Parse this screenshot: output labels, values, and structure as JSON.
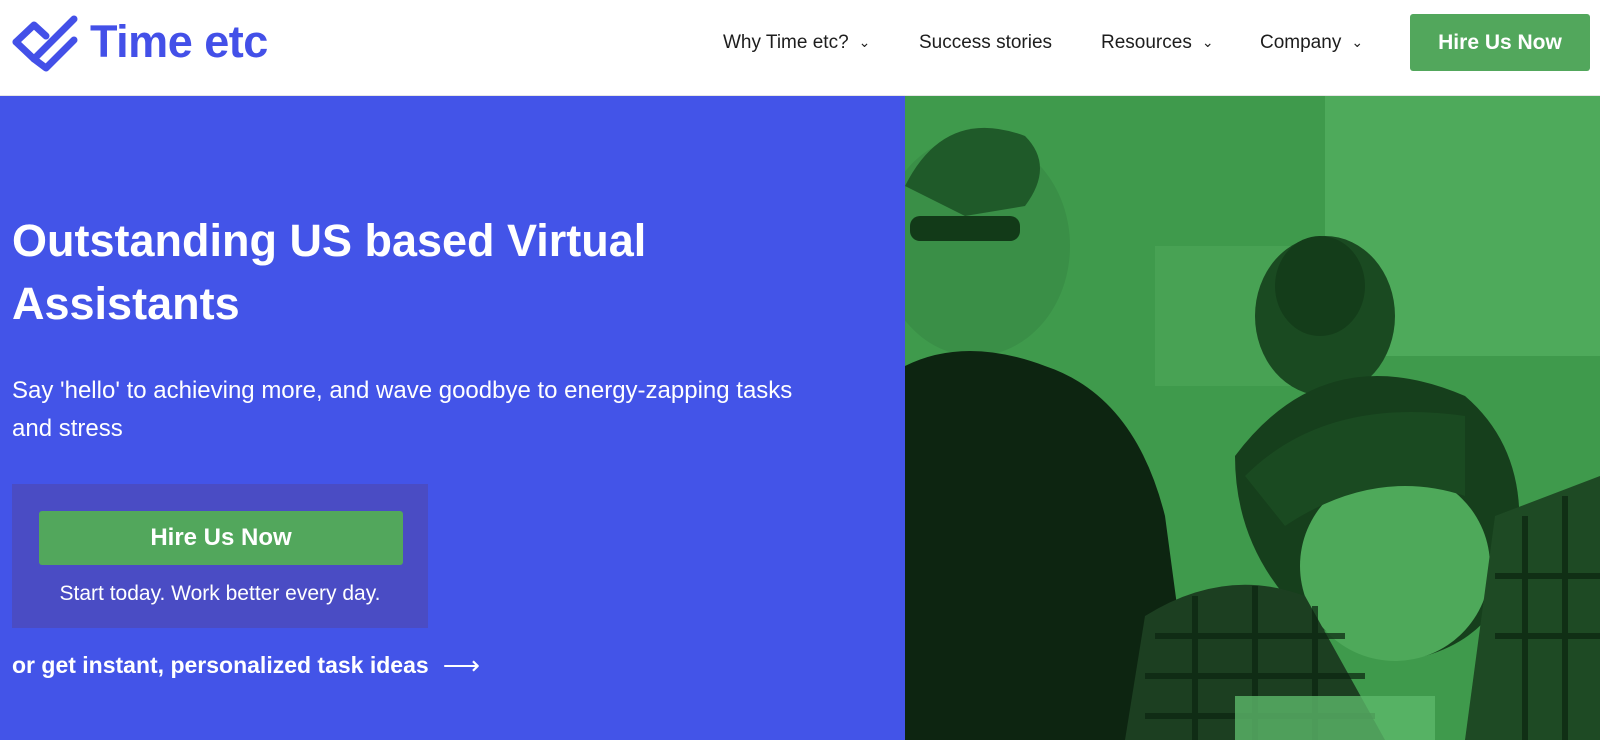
{
  "brand": {
    "name": "Time etc",
    "color": "#4350e8"
  },
  "nav": {
    "items": [
      {
        "label": "Why Time etc?",
        "has_dropdown": true
      },
      {
        "label": "Success stories",
        "has_dropdown": false
      },
      {
        "label": "Resources",
        "has_dropdown": true
      },
      {
        "label": "Company",
        "has_dropdown": true
      }
    ],
    "cta_label": "Hire Us Now"
  },
  "hero": {
    "headline": "Outstanding US based Virtual Assistants",
    "subheadline": "Say 'hello' to achieving more, and wave goodbye to energy-zapping tasks and stress",
    "cta_label": "Hire Us Now",
    "cta_caption": "Start today. Work better every day.",
    "secondary_link": "or get instant, personalized task ideas",
    "background_color": "#4354e8",
    "image_tint": "#3f9a4c"
  },
  "icons": {
    "chevron": "chevron-down-icon",
    "arrow": "arrow-right-icon",
    "logo": "checkmark-logo-icon"
  }
}
